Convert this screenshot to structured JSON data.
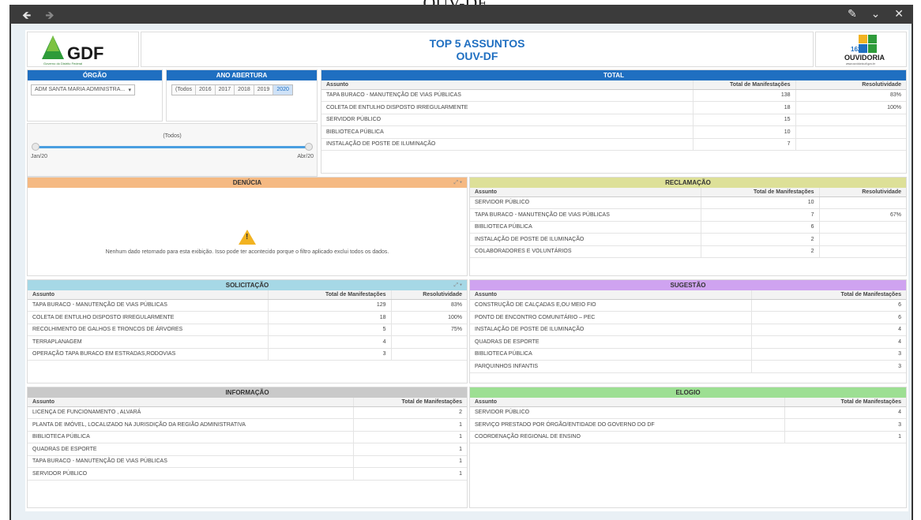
{
  "page_header": "OUV-DF",
  "chrome": {
    "back_icon": "back-arrow-icon",
    "forward_icon": "forward-arrow-icon",
    "edit_icon": "edit-pencil-icon",
    "minimize_icon": "chevron-down-icon",
    "close_icon": "close-icon"
  },
  "header": {
    "title": "TOP 5 ASSUNTOS",
    "subtitle": "OUV-DF",
    "gdf_logo_text": "GDF",
    "gdf_logo_sub": "Governo do Distrito Federal",
    "ouv_logo_text": "OUVIDORIA",
    "ouv_logo_num": "162",
    "ouv_logo_url": "www.ouvidoria.df.gov.br"
  },
  "filters": {
    "orgao": {
      "label": "ÓRGÃO",
      "selected": "ADM SANTA MARIA ADMINISTRA..."
    },
    "ano": {
      "label": "ANO ABERTURA",
      "options": [
        "(Todos",
        "2016",
        "2017",
        "2018",
        "2019",
        "2020"
      ],
      "selected": "2020"
    },
    "slider": {
      "label": "(Todos)",
      "start": "Jan/20",
      "end": "Abr/20"
    }
  },
  "total": {
    "title": "TOTAL",
    "columns": [
      "Assunto",
      "Total de Manifestações",
      "Resolutividade"
    ],
    "rows": [
      [
        "TAPA BURACO - MANUTENÇÃO DE VIAS PÚBLICAS",
        "138",
        "83%"
      ],
      [
        "COLETA DE ENTULHO DISPOSTO IRREGULARMENTE",
        "18",
        "100%"
      ],
      [
        "SERVIDOR PÚBLICO",
        "15",
        ""
      ],
      [
        "BIBLIOTECA PÚBLICA",
        "10",
        ""
      ],
      [
        "INSTALAÇÃO DE POSTE DE ILUMINAÇÃO",
        "7",
        ""
      ]
    ]
  },
  "denuncia": {
    "title": "DENÚCIA",
    "message": "Nenhum dado retornado para esta exibição. Isso pode ter acontecido porque o filtro aplicado exclui todos os dados."
  },
  "reclamacao": {
    "title": "RECLAMAÇÃO",
    "columns": [
      "Assunto",
      "Total de Manifestações",
      "Resolutividade"
    ],
    "rows": [
      [
        "SERVIDOR PÚBLICO",
        "10",
        ""
      ],
      [
        "TAPA BURACO - MANUTENÇÃO DE VIAS PÚBLICAS",
        "7",
        "67%"
      ],
      [
        "BIBLIOTECA PÚBLICA",
        "6",
        ""
      ],
      [
        "INSTALAÇÃO DE POSTE DE ILUMINAÇÃO",
        "2",
        ""
      ],
      [
        "COLABORADORES E VOLUNTÁRIOS",
        "2",
        ""
      ]
    ]
  },
  "solicitacao": {
    "title": "SOLICITAÇÃO",
    "columns": [
      "Assunto",
      "Total de Manifestações",
      "Resolutividade"
    ],
    "rows": [
      [
        "TAPA BURACO - MANUTENÇÃO DE VIAS PÚBLICAS",
        "129",
        "83%"
      ],
      [
        "COLETA DE ENTULHO DISPOSTO IRREGULARMENTE",
        "18",
        "100%"
      ],
      [
        "RECOLHIMENTO DE GALHOS E TRONCOS DE ÁRVORES",
        "5",
        "75%"
      ],
      [
        "TERRAPLANAGEM",
        "4",
        ""
      ],
      [
        "OPERAÇÃO TAPA BURACO EM ESTRADAS,RODOVIAS",
        "3",
        ""
      ]
    ]
  },
  "sugestao": {
    "title": "SUGESTÃO",
    "columns": [
      "Assunto",
      "Total de Manifestações"
    ],
    "rows": [
      [
        "CONSTRUÇÃO DE CALÇADAS E,OU MEIO FIO",
        "6"
      ],
      [
        "PONTO DE ENCONTRO COMUNITÁRIO – PEC",
        "6"
      ],
      [
        "INSTALAÇÃO DE POSTE DE ILUMINAÇÃO",
        "4"
      ],
      [
        "QUADRAS DE ESPORTE",
        "4"
      ],
      [
        "BIBLIOTECA PÚBLICA",
        "3"
      ],
      [
        "PARQUINHOS INFANTIS",
        "3"
      ]
    ]
  },
  "informacao": {
    "title": "INFORMAÇÃO",
    "columns": [
      "Assunto",
      "Total de Manifestações"
    ],
    "rows": [
      [
        "LICENÇA DE FUNCIONAMENTO , ALVARÁ",
        "2"
      ],
      [
        "PLANTA DE IMÓVEL, LOCALIZADO NA JURISDIÇÃO DA REGIÃO ADMINISTRATIVA",
        "1"
      ],
      [
        "BIBLIOTECA PÚBLICA",
        "1"
      ],
      [
        "QUADRAS DE ESPORTE",
        "1"
      ],
      [
        "TAPA BURACO - MANUTENÇÃO DE VIAS PÚBLICAS",
        "1"
      ],
      [
        "SERVIDOR PÚBLICO",
        "1"
      ]
    ]
  },
  "elogio": {
    "title": "ELOGIO",
    "columns": [
      "Assunto",
      "Total de Manifestações"
    ],
    "rows": [
      [
        "SERVIDOR PÚBLICO",
        "4"
      ],
      [
        "SERVIÇO PRESTADO POR ÓRGÃO/ENTIDADE DO GOVERNO DO DF",
        "3"
      ],
      [
        "COORDENAÇÃO REGIONAL DE ENSINO",
        "1"
      ]
    ]
  }
}
